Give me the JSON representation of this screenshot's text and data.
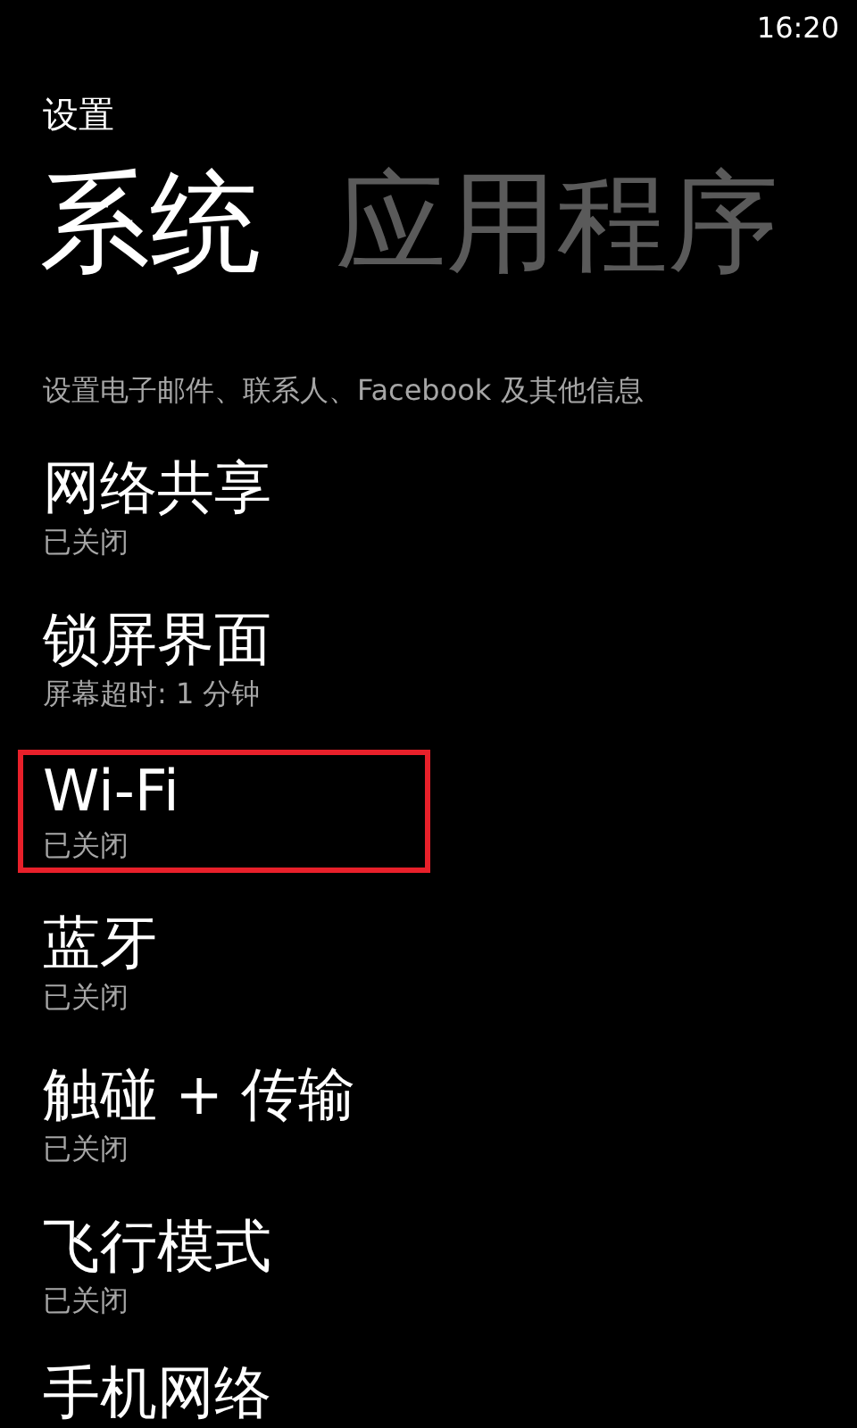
{
  "status_bar": {
    "time": "16:20"
  },
  "header": {
    "title": "设置"
  },
  "pivot": [
    {
      "label": "系统",
      "selected": true
    },
    {
      "label": "应用程序",
      "selected": false
    }
  ],
  "items": [
    {
      "subtitle": "设置电子邮件、联系人、Facebook 及其他信息",
      "highlighted": false
    },
    {
      "title": "网络共享",
      "subtitle": "已关闭",
      "highlighted": false
    },
    {
      "title": "锁屏界面",
      "subtitle": "屏幕超时: 1 分钟",
      "highlighted": false
    },
    {
      "title": "Wi-Fi",
      "subtitle": "已关闭",
      "highlighted": true
    },
    {
      "title": "蓝牙",
      "subtitle": "已关闭",
      "highlighted": false
    },
    {
      "title": "触碰 + 传输",
      "subtitle": "已关闭",
      "highlighted": false
    },
    {
      "title": "飞行模式",
      "subtitle": "已关闭",
      "highlighted": false
    },
    {
      "title": "手机网络",
      "highlighted": false
    }
  ]
}
